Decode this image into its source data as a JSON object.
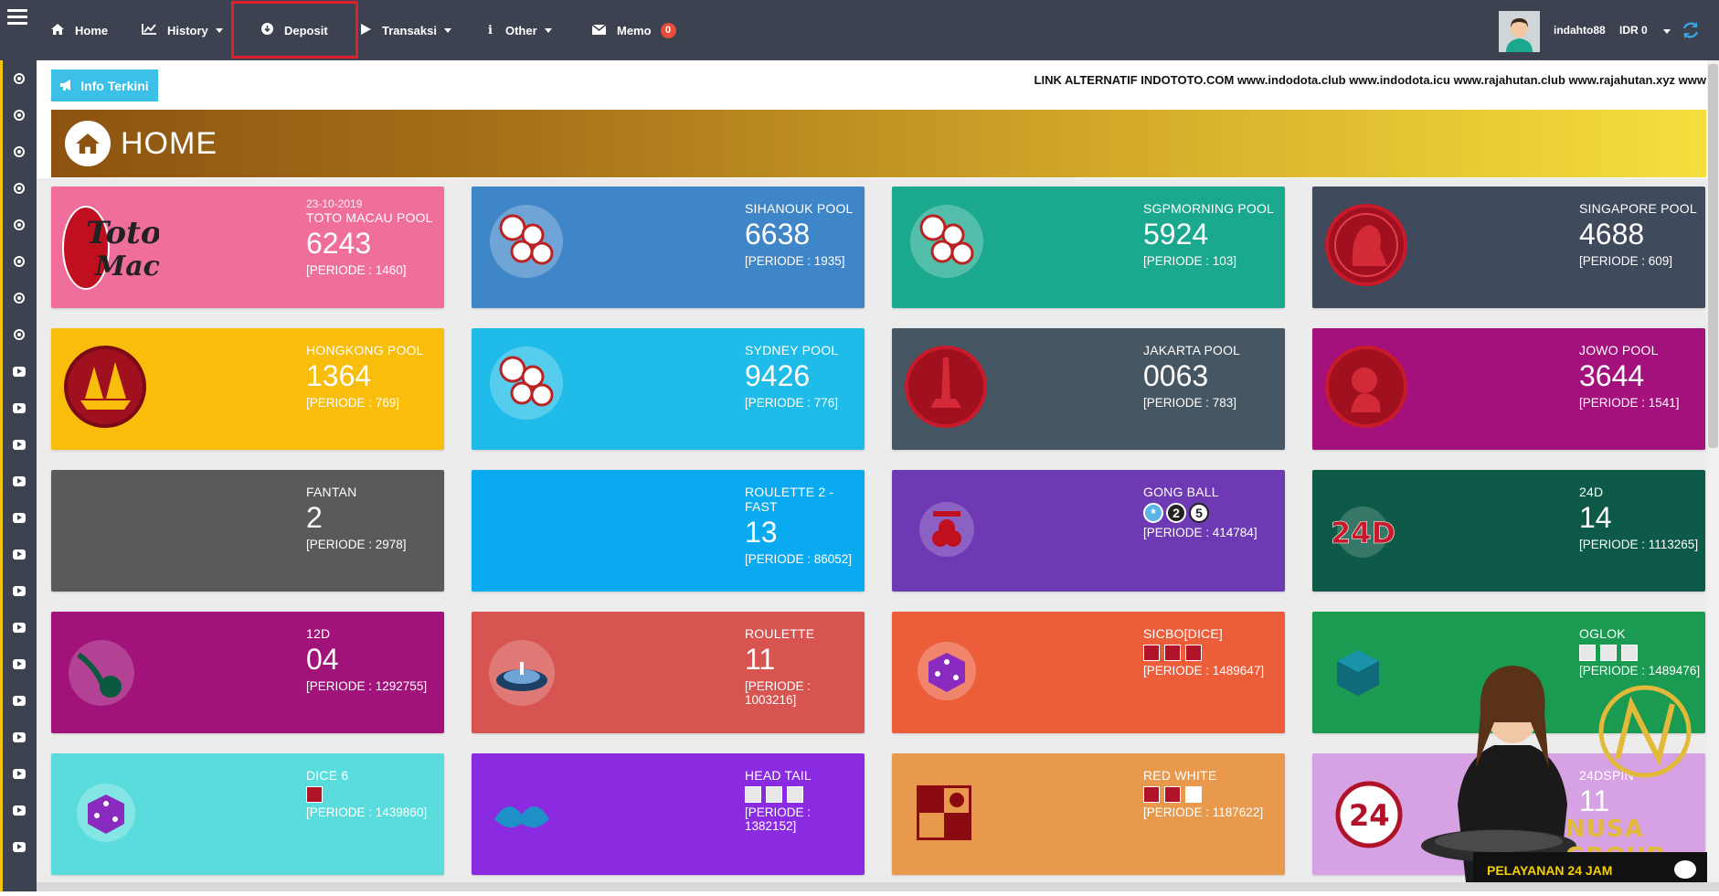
{
  "topbar": {
    "nav": [
      {
        "label": "Home",
        "icon": "home-icon",
        "has_caret": false
      },
      {
        "label": "History",
        "icon": "chart-icon",
        "has_caret": true
      },
      {
        "label": "Deposit",
        "icon": "arrow-down-circle-icon",
        "has_caret": false
      },
      {
        "label": "Transaksi",
        "icon": "play-icon",
        "has_caret": true
      },
      {
        "label": "Other",
        "icon": "info-icon",
        "has_caret": true
      },
      {
        "label": "Memo",
        "icon": "envelope-icon",
        "has_caret": false
      }
    ],
    "memo_count": "0",
    "username": "indahto88",
    "balance": "IDR 0"
  },
  "info": {
    "button_label": "Info Terkini",
    "marquee": "LINK ALTERNATIF INDOTOTO.COM www.indodota.club www.indodota.icu www.rajahutan.club www.rajahutan.xyz www"
  },
  "page": {
    "title": "HOME"
  },
  "cards": [
    {
      "name": "TOTO MACAU POOL",
      "date": "23-10-2019",
      "result": "6243",
      "period": "[PERIODE : 1460]",
      "color": "#f06e9c",
      "icon": "toto-macau-logo"
    },
    {
      "name": "SIHANOUK POOL",
      "result": "6638",
      "period": "[PERIODE : 1935]",
      "color": "#3f86c9",
      "icon": "lottery-balls-icon"
    },
    {
      "name": "SGPMORNING POOL",
      "result": "5924",
      "period": "[PERIODE : 103]",
      "color": "#1aa98e",
      "icon": "lottery-balls-icon"
    },
    {
      "name": "SINGAPORE POOL",
      "result": "4688",
      "period": "[PERIODE : 609]",
      "color": "#3f4a5c",
      "icon": "merlion-icon"
    },
    {
      "name": "HONGKONG POOL",
      "result": "1364",
      "period": "[PERIODE : 769]",
      "color": "#f9bd0c",
      "icon": "junk-ship-icon"
    },
    {
      "name": "SYDNEY POOL",
      "result": "9426",
      "period": "[PERIODE : 776]",
      "color": "#1fbce9",
      "icon": "lottery-balls-icon"
    },
    {
      "name": "JAKARTA POOL",
      "result": "0063",
      "period": "[PERIODE : 783]",
      "color": "#475663",
      "icon": "monas-icon"
    },
    {
      "name": "JOWO POOL",
      "result": "3644",
      "period": "[PERIODE : 1541]",
      "color": "#a4107c",
      "icon": "monkey-icon"
    },
    {
      "name": "FANTAN",
      "result": "2",
      "period": "[PERIODE : 2978]",
      "color": "#5a5a5a",
      "icon": ""
    },
    {
      "name": "ROULETTE 2 - FAST",
      "result": "13",
      "period": "[PERIODE : 86052]",
      "color": "#0aaaf0",
      "icon": ""
    },
    {
      "name": "GONG BALL",
      "balls": [
        "*",
        "2",
        "5"
      ],
      "period": "[PERIODE : 414784]",
      "color": "#6e3ab4",
      "icon": "gong-icon"
    },
    {
      "name": "24D",
      "result": "14",
      "period": "[PERIODE : 1113265]",
      "color": "#0c5a47",
      "icon": "24d-logo"
    },
    {
      "name": "12D",
      "result": "04",
      "period": "[PERIODE : 1292755]",
      "color": "#a1127a",
      "icon": "12d-logo"
    },
    {
      "name": "ROULETTE",
      "result": "11",
      "period": "[PERIODE : 1003216]",
      "color": "#d75450",
      "icon": "roulette-wheel-icon"
    },
    {
      "name": "SICBO[DICE]",
      "dice": 3,
      "period": "[PERIODE : 1489647]",
      "color": "#ec5d3a",
      "icon": "dice-icon"
    },
    {
      "name": "OGLOK",
      "dice": 3,
      "period": "[PERIODE : 1489476]",
      "color": "#1b9a52",
      "icon": "oglok-dice-icon"
    },
    {
      "name": "DICE 6",
      "dice": 1,
      "period": "[PERIODE : 1439860]",
      "color": "#5bdcdc",
      "icon": "dice-icon"
    },
    {
      "name": "HEAD TAIL",
      "dice": 3,
      "period": "[PERIODE : 1382152]",
      "color": "#8a2be2",
      "icon": "dragon-icon"
    },
    {
      "name": "RED WHITE",
      "dice": 3,
      "period": "[PERIODE : 1187622]",
      "color": "#e8994c",
      "icon": "red-white-icon"
    },
    {
      "name": "24DSPIN",
      "result": "11",
      "period": "",
      "color": "#d6a2e3",
      "icon": "24-spin-logo"
    }
  ],
  "promo": {
    "brand": "NUSA GROUP",
    "chat_label": "PELAYANAN 24 JAM"
  }
}
